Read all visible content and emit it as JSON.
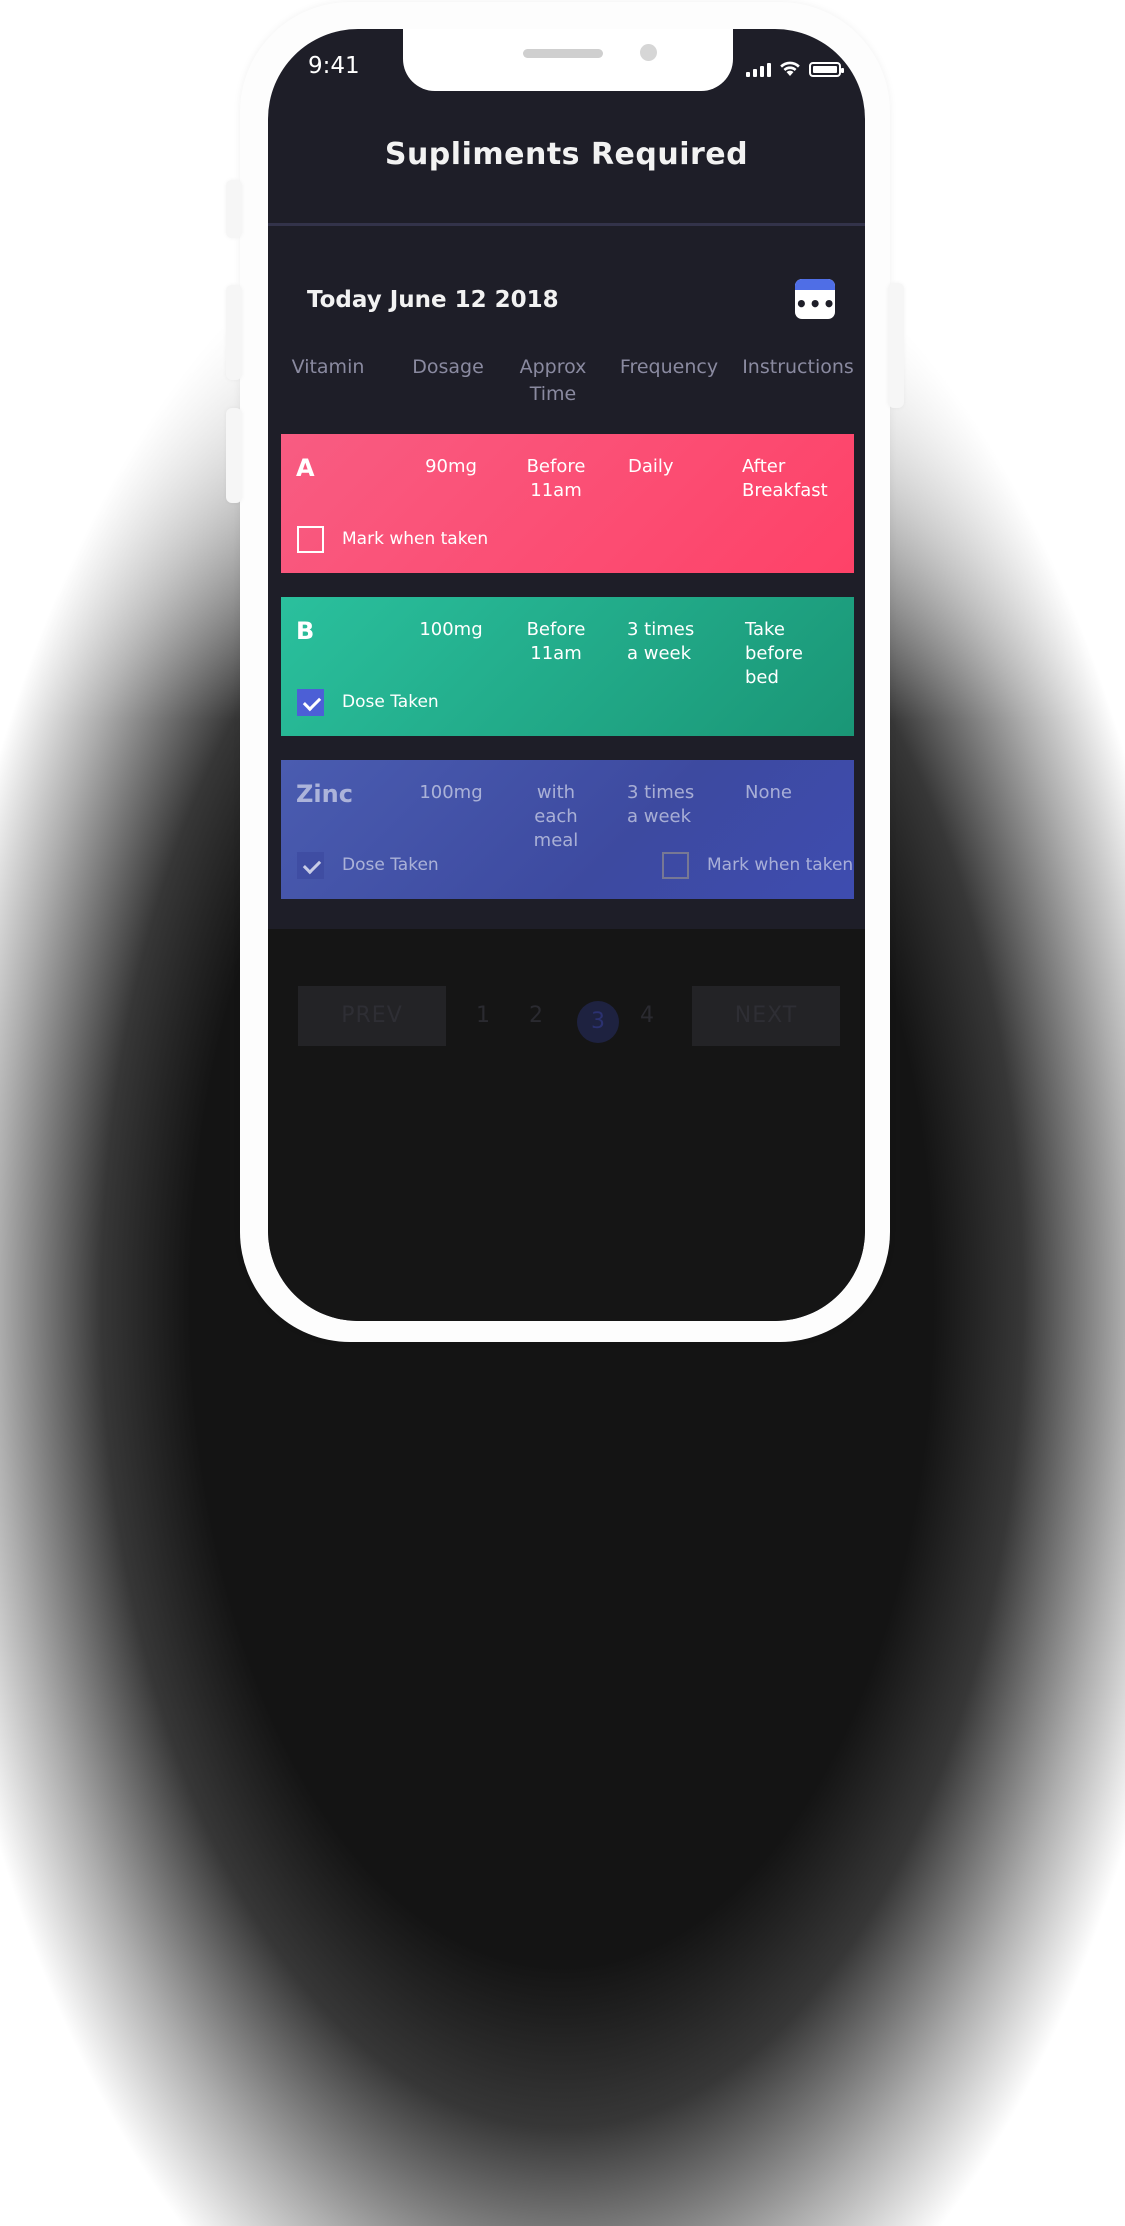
{
  "status_bar": {
    "time": "9:41"
  },
  "header": {
    "title": "Supliments Required"
  },
  "date": {
    "label": "Today June 12 2018"
  },
  "calendar_button": {
    "icon": "calendar-icon",
    "dots": "•••"
  },
  "columns": {
    "vitamin": "Vitamin",
    "dosage": "Dosage",
    "time_line1": "Approx",
    "time_line2": "Time",
    "frequency": "Frequency",
    "instructions": "Instructions"
  },
  "cards": [
    {
      "vitamin": "A",
      "dosage": "90mg",
      "time": [
        "Before",
        "11am"
      ],
      "frequency": [
        "Daily"
      ],
      "instructions": [
        "After",
        "Breakfast"
      ],
      "checkbox_label": "Mark when taken",
      "checked": false,
      "color": "#fe4268"
    },
    {
      "vitamin": "B",
      "dosage": "100mg",
      "time": [
        "Before",
        "11am"
      ],
      "frequency": [
        "3 times",
        "a week"
      ],
      "instructions": [
        "Take",
        "before",
        "bed"
      ],
      "checkbox_label": "Dose Taken",
      "checked": true,
      "color": "#22b08b"
    },
    {
      "vitamin": "Zinc",
      "dosage": "100mg",
      "time": [
        "with",
        "each",
        "meal"
      ],
      "frequency": [
        "3 times",
        "a week"
      ],
      "instructions": [
        "None"
      ],
      "checkbox_label": "Dose Taken",
      "checked": true,
      "secondary_checkbox_label": "Mark when taken",
      "secondary_checked": false,
      "color": "#3e4cb0"
    }
  ],
  "pagination": {
    "prev": "PREV",
    "next": "NEXT",
    "pages": [
      "1",
      "2",
      "3",
      "4"
    ],
    "current": "3"
  }
}
